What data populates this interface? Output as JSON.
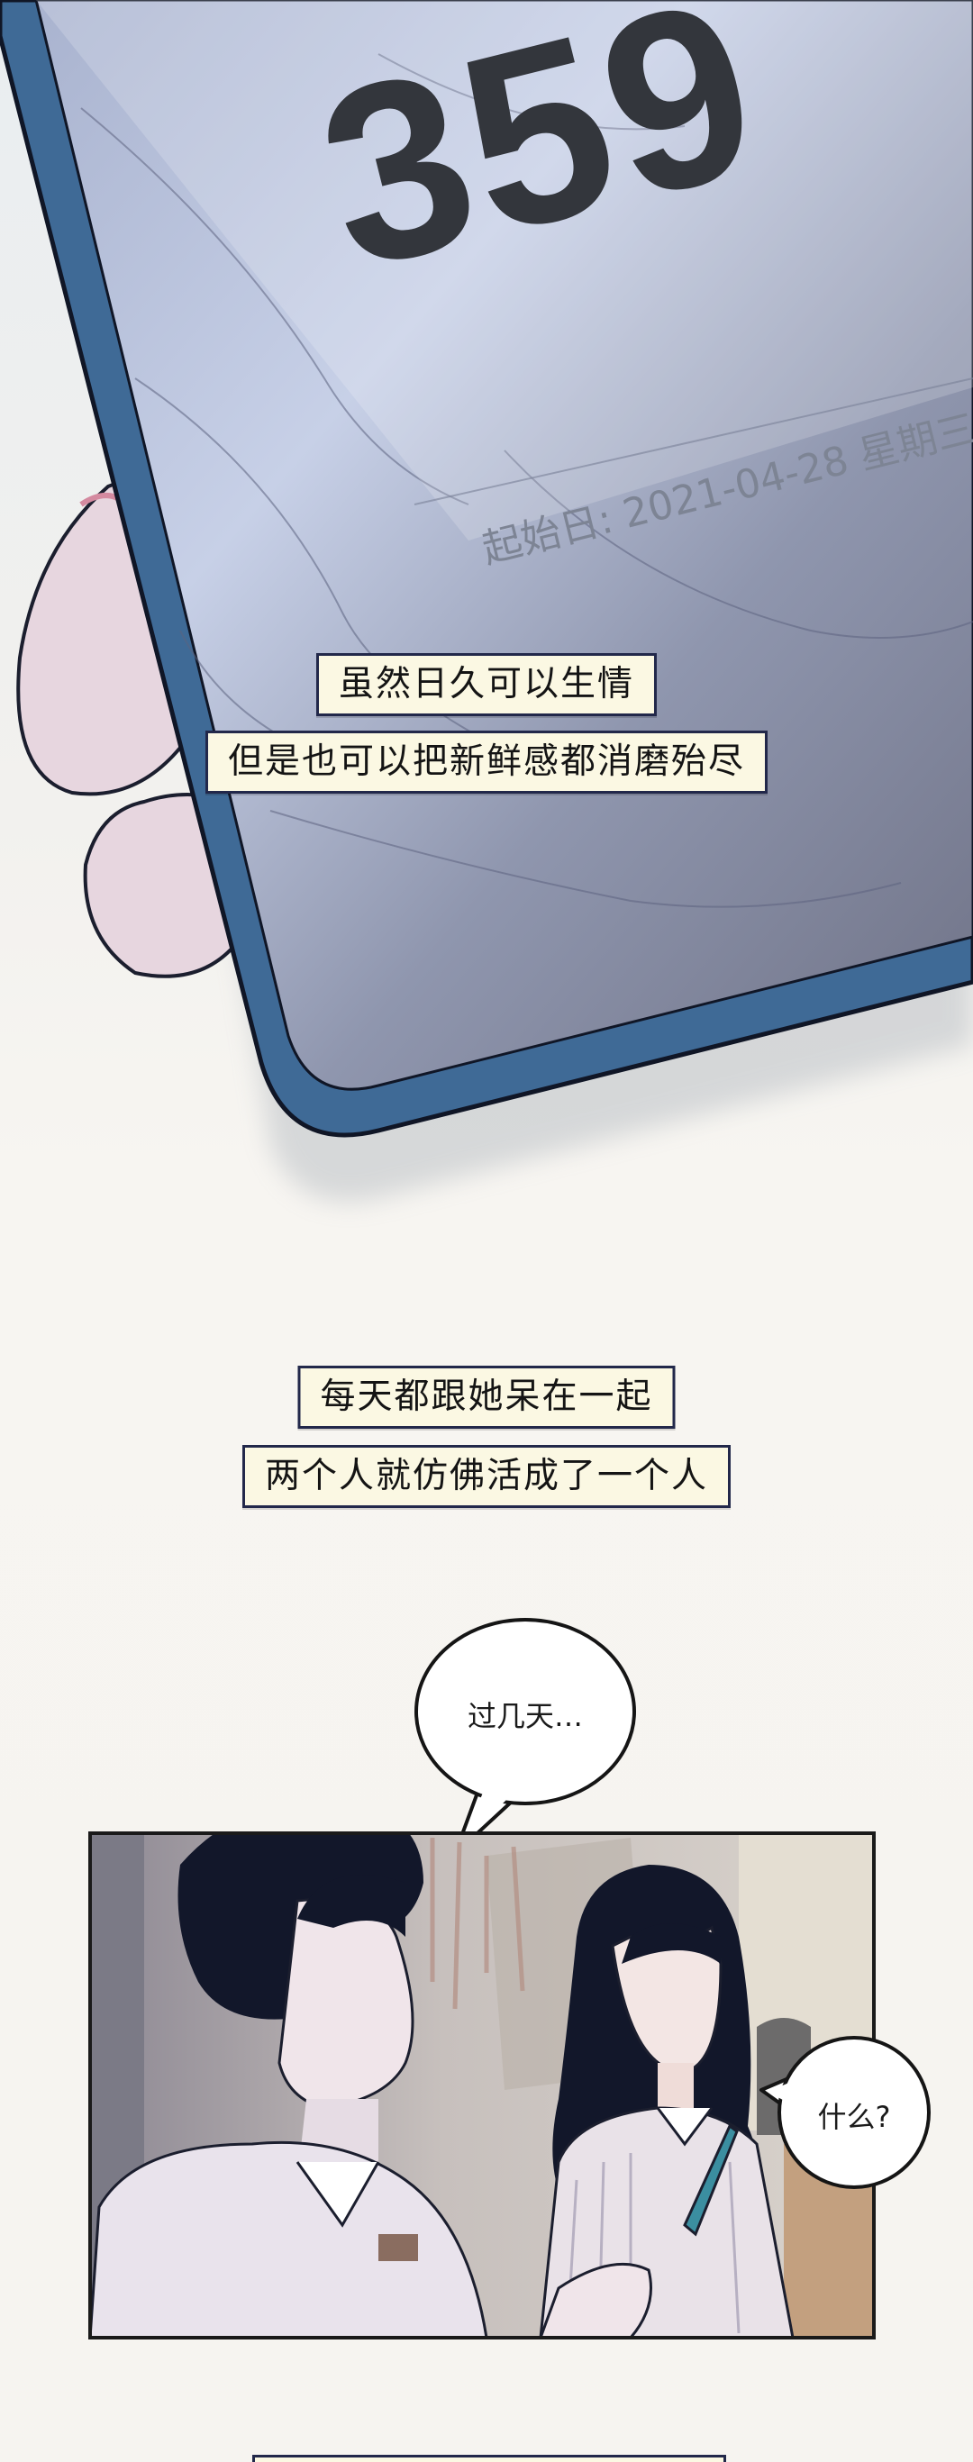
{
  "phone": {
    "counter": "359",
    "start_date": "起始日: 2021-04-28 星期三"
  },
  "captions": [
    "虽然日久可以生情",
    "但是也可以把新鲜感都消磨殆尽",
    "每天都跟她呆在一起",
    "两个人就仿佛活成了一个人"
  ],
  "bubbles": {
    "man": "过几天…",
    "woman": "什么?"
  },
  "colors": {
    "phone_frame": "#3f6a96",
    "caption_bg": "#fbf8e3",
    "caption_border": "#22284a",
    "hair": "#12172a"
  }
}
